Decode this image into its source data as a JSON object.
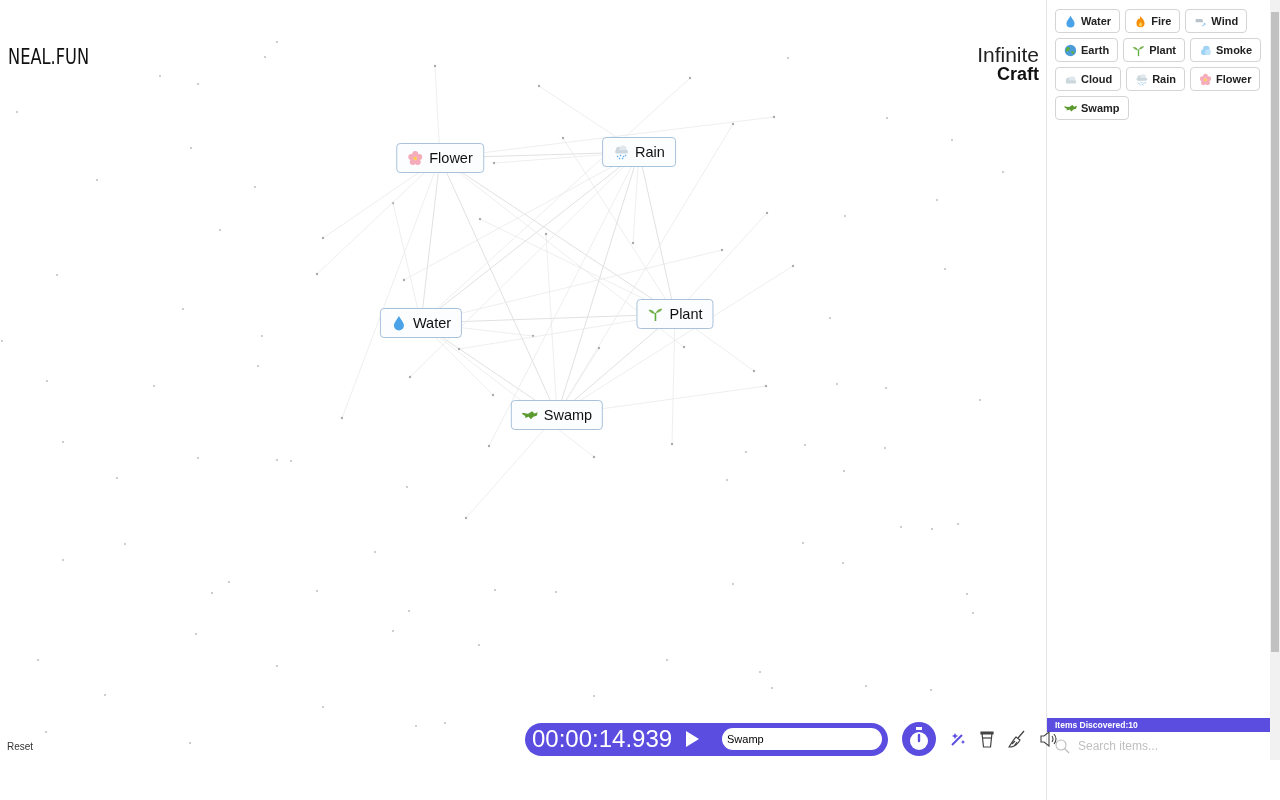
{
  "logo": "NEAL.FUN",
  "title": {
    "line1": "Infinite",
    "line2": "Craft"
  },
  "canvas": {
    "nodes": [
      {
        "kind": "flower",
        "label": "Flower"
      },
      {
        "kind": "rain",
        "label": "Rain"
      },
      {
        "kind": "water",
        "label": "Water"
      },
      {
        "kind": "plant",
        "label": "Plant"
      },
      {
        "kind": "swamp",
        "label": "Swamp"
      }
    ]
  },
  "sidebar": {
    "items": [
      {
        "kind": "water",
        "label": "Water"
      },
      {
        "kind": "fire",
        "label": "Fire"
      },
      {
        "kind": "wind",
        "label": "Wind"
      },
      {
        "kind": "earth",
        "label": "Earth"
      },
      {
        "kind": "plant",
        "label": "Plant"
      },
      {
        "kind": "smoke",
        "label": "Smoke"
      },
      {
        "kind": "cloud",
        "label": "Cloud"
      },
      {
        "kind": "rain",
        "label": "Rain"
      },
      {
        "kind": "flower",
        "label": "Flower"
      },
      {
        "kind": "swamp",
        "label": "Swamp"
      }
    ],
    "counter": "Items Discovered:10",
    "search": {
      "placeholder": "Search items..."
    }
  },
  "timer_bar": {
    "time": "00:00:14.939",
    "target": "Swamp"
  },
  "reset": "Reset"
}
